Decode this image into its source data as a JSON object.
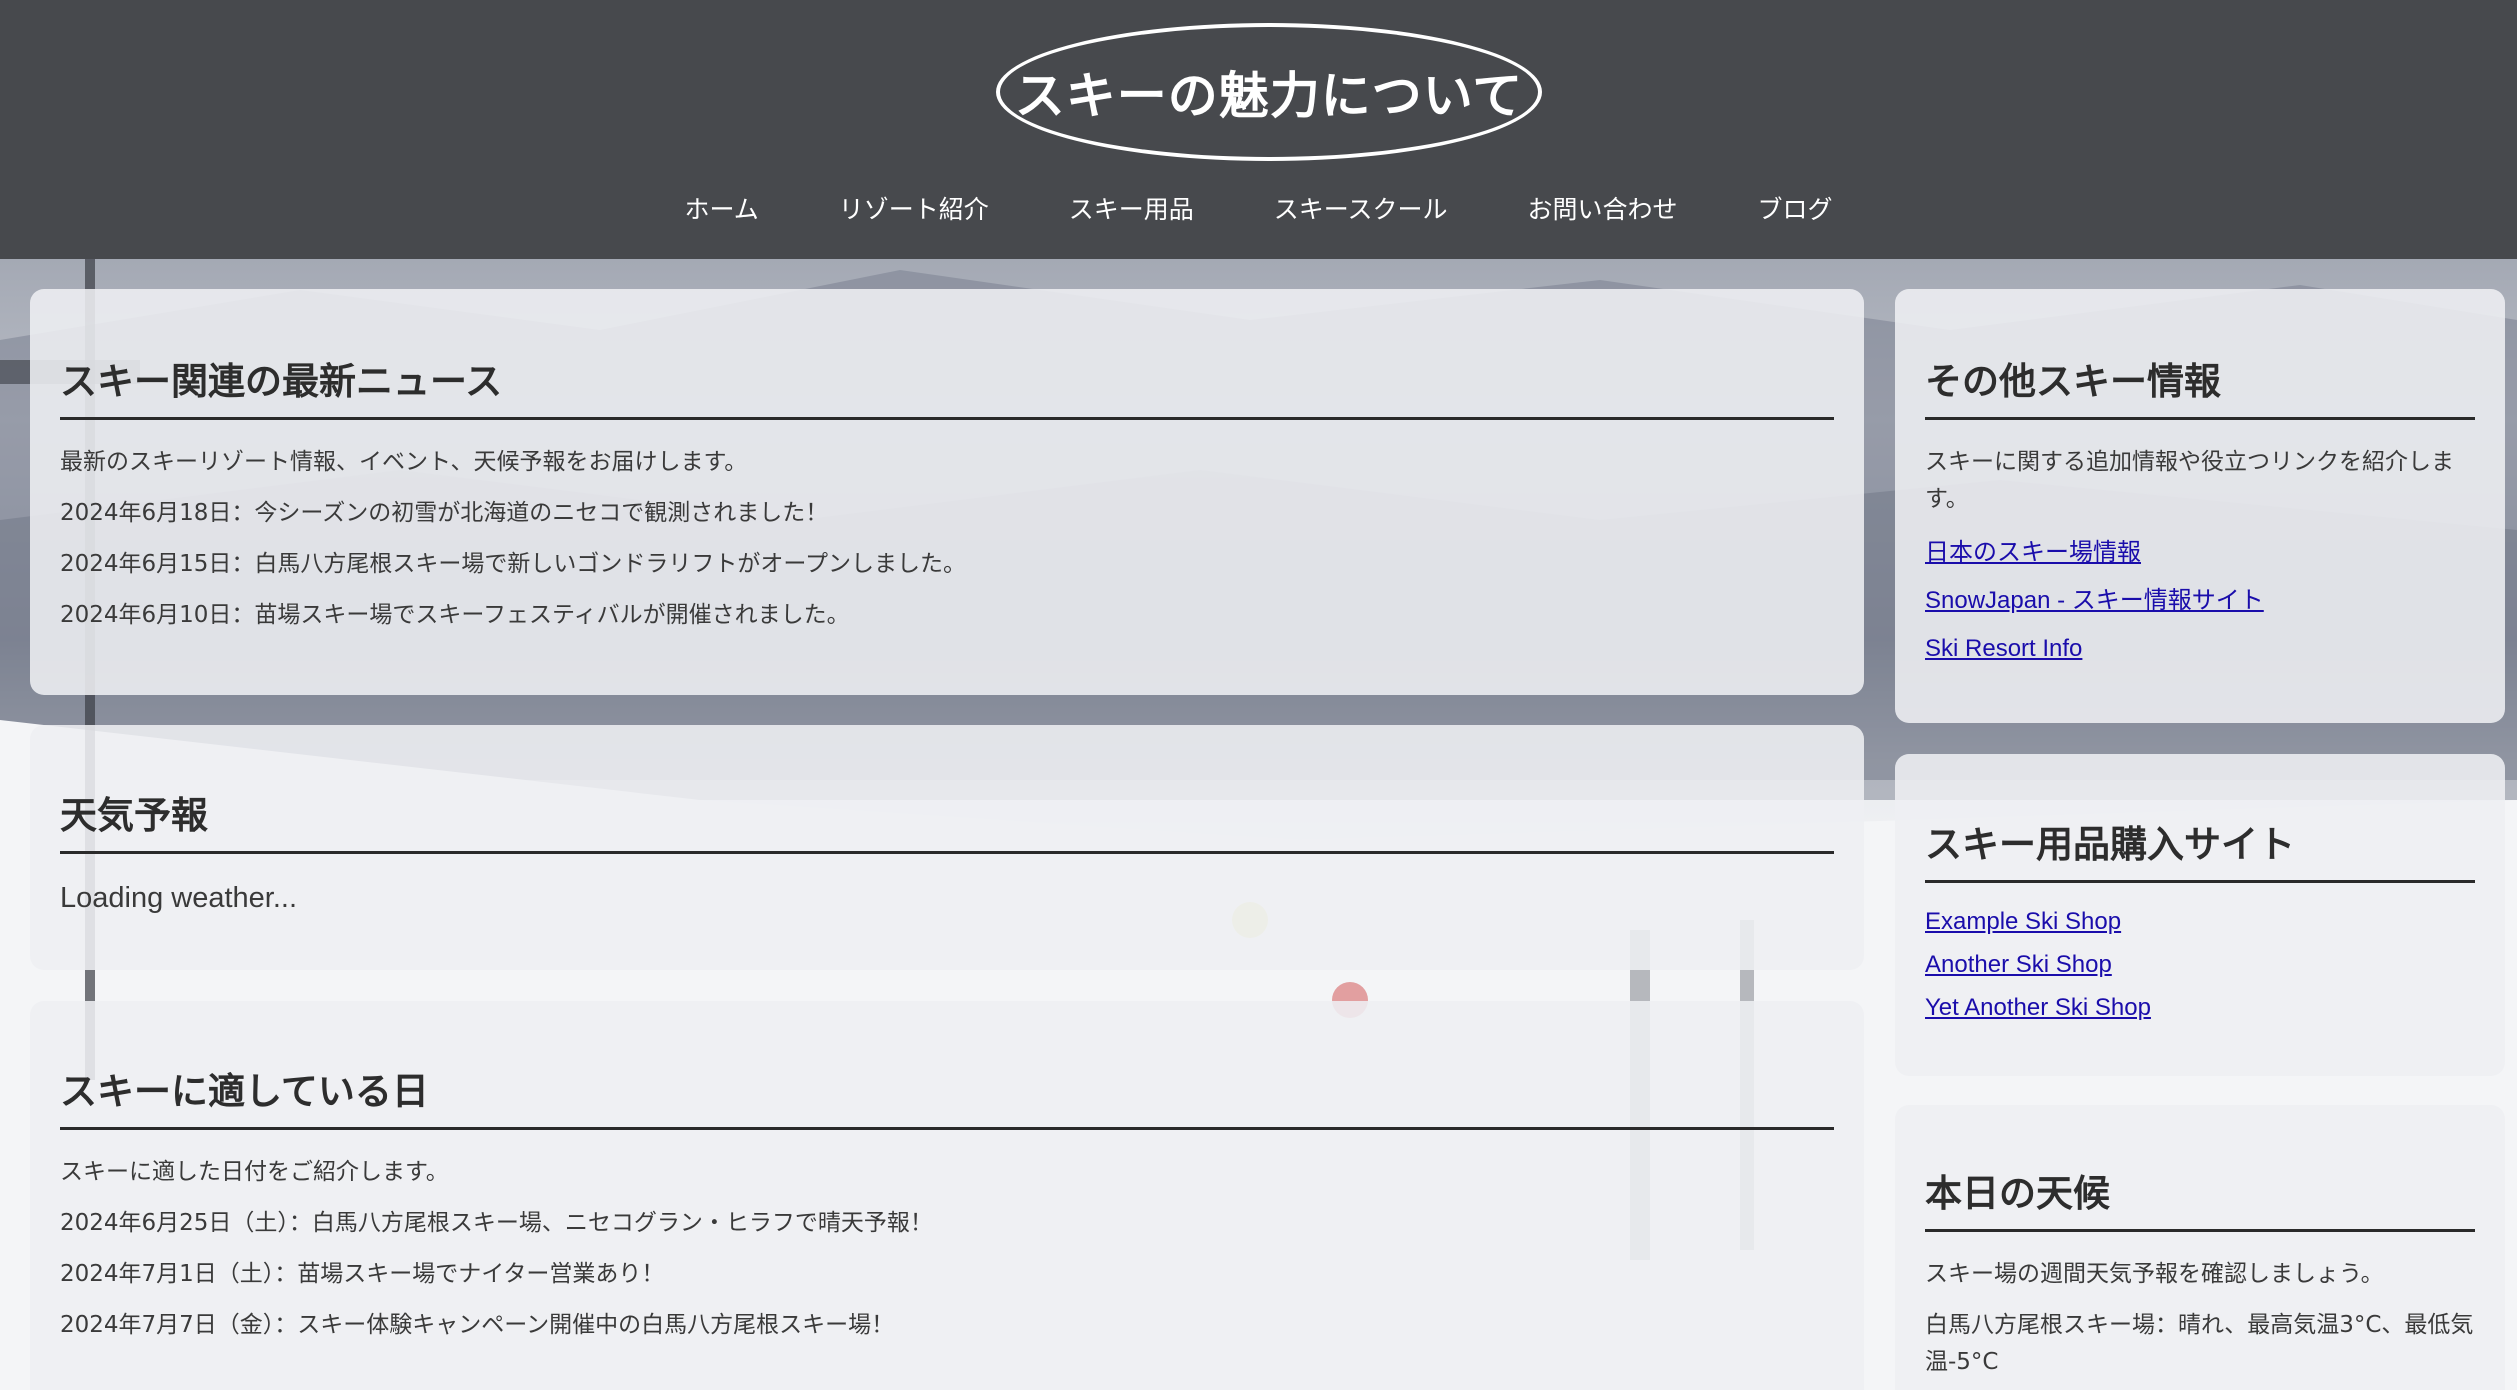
{
  "site": {
    "title": "スキーの魅力について"
  },
  "nav": {
    "items": [
      "ホーム",
      "リゾート紹介",
      "スキー用品",
      "スキースクール",
      "お問い合わせ",
      "ブログ"
    ]
  },
  "news": {
    "heading": "スキー関連の最新ニュース",
    "intro": "最新のスキーリゾート情報、イベント、天候予報をお届けします。",
    "items": [
      "2024年6月18日：今シーズンの初雪が北海道のニセコで観測されました！",
      "2024年6月15日：白馬八方尾根スキー場で新しいゴンドラリフトがオープンしました。",
      "2024年6月10日：苗場スキー場でスキーフェスティバルが開催されました。"
    ]
  },
  "weather": {
    "heading": "天気予報",
    "status": "Loading weather..."
  },
  "good_days": {
    "heading": "スキーに適している日",
    "intro": "スキーに適した日付をご紹介します。",
    "items": [
      "2024年6月25日（土）：白馬八方尾根スキー場、ニセコグラン・ヒラフで晴天予報！",
      "2024年7月1日（土）：苗場スキー場でナイター営業あり！",
      "2024年7月7日（金）：スキー体験キャンペーン開催中の白馬八方尾根スキー場！"
    ]
  },
  "other_info": {
    "heading": "その他スキー情報",
    "intro": "スキーに関する追加情報や役立つリンクを紹介します。",
    "links": [
      "日本のスキー場情報",
      "SnowJapan - スキー情報サイト",
      "Ski Resort Info"
    ]
  },
  "shops": {
    "heading": "スキー用品購入サイト",
    "links": [
      "Example Ski Shop",
      "Another Ski Shop",
      "Yet Another Ski Shop"
    ]
  },
  "today": {
    "heading": "本日の天候",
    "intro": "スキー場の週間天気予報を確認しましょう。",
    "item": "白馬八方尾根スキー場：晴れ、最高気温3°C、最低気温-5°C"
  },
  "colors": {
    "header_bg": "#47494d",
    "link": "#1a0dab",
    "panel_bg": "rgba(238,239,242,0.88)"
  }
}
